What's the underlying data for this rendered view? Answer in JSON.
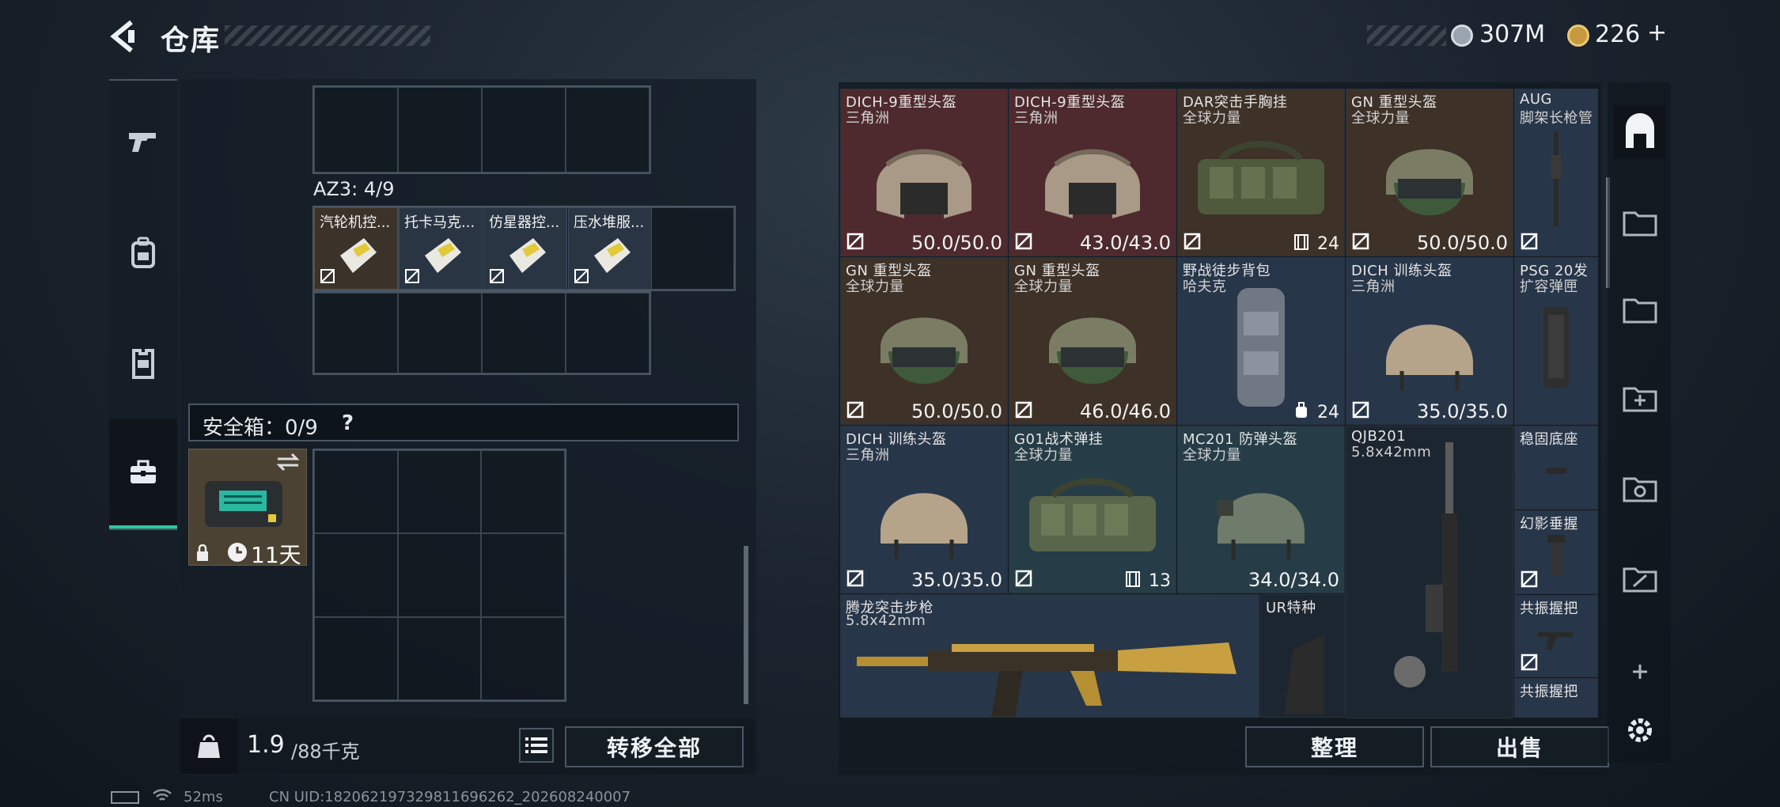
{
  "header": {
    "title": "仓库",
    "currency1": "307M",
    "currency2": "226",
    "plus": "+"
  },
  "nav": {
    "items": [
      "pistol",
      "backpack",
      "vest",
      "safebox"
    ]
  },
  "left": {
    "az3_label": "AZ3: 4/9",
    "az3_items": [
      "汽轮机控...",
      "托卡马克...",
      "仿星器控...",
      "压水堆服..."
    ],
    "safe_label": "安全箱：0/9",
    "safe_help": "?",
    "safe_timer": "11天",
    "weight": "1.9",
    "weight_unit": "/88千克",
    "weight_icon_text": "KG",
    "transfer_all": "转移全部"
  },
  "right": {
    "items": [
      {
        "n1": "DICH-9重型头盔",
        "n2": "三角洲",
        "dur": "50.0/50.0"
      },
      {
        "n1": "DICH-9重型头盔",
        "n2": "三角洲",
        "dur": "43.0/43.0"
      },
      {
        "n1": "DAR突击手胸挂",
        "n2": "全球力量",
        "cnt": "24"
      },
      {
        "n1": "GN 重型头盔",
        "n2": "全球力量",
        "dur": "50.0/50.0"
      },
      {
        "n1": "AUG",
        "n2": "脚架长枪管"
      },
      {
        "n1": "GN 重型头盔",
        "n2": "全球力量",
        "dur": "50.0/50.0"
      },
      {
        "n1": "GN 重型头盔",
        "n2": "全球力量",
        "dur": "46.0/46.0"
      },
      {
        "n1": "野战徒步背包",
        "n2": "哈夫克",
        "cnt": "24"
      },
      {
        "n1": "DICH 训练头盔",
        "n2": "三角洲",
        "dur": "35.0/35.0"
      },
      {
        "n1": "PSG 20发",
        "n2": "扩容弹匣"
      },
      {
        "n1": "DICH 训练头盔",
        "n2": "三角洲",
        "dur": "35.0/35.0"
      },
      {
        "n1": "G01战术弹挂",
        "n2": "全球力量",
        "cnt": "13"
      },
      {
        "n1": "MC201 防弹头盔",
        "n2": "全球力量",
        "dur": "34.0/34.0"
      },
      {
        "n1": "QJB201",
        "n2": "5.8x42mm"
      },
      {
        "n1": "稳固底座",
        "n2": ""
      },
      {
        "n1": "幻影垂握",
        "n2": ""
      },
      {
        "n1": "腾龙突击步枪",
        "n2": "5.8x42mm"
      },
      {
        "n1": "UR特种",
        "n2": ""
      },
      {
        "n1": "共振握把",
        "n2": ""
      },
      {
        "n1": "共振握把",
        "n2": ""
      }
    ],
    "sort": "整理",
    "sell": "出售"
  },
  "status": {
    "ping": "52ms",
    "uid": "CN UID:18206219732981169626​2_202608240007"
  },
  "colors": {
    "accent": "#29c7a6",
    "red": "#4e2a2e",
    "brown": "#3e3127",
    "blue": "#28364a"
  }
}
